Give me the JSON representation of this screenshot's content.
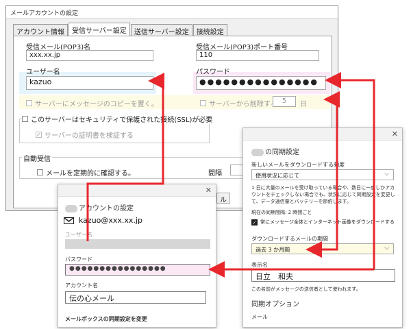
{
  "legacy": {
    "title": "メールアカウントの設定",
    "tabs": [
      "アカウント情報",
      "受信サーバー設定",
      "送信サーバー設定",
      "接続設定"
    ],
    "pop3_label": "受信メール(POP3)名",
    "pop3_value": "xxx.xx.jp",
    "port_label": "受信メール(POP3)ポート番号",
    "port_value": "110",
    "username_label": "ユーザー名",
    "username_value": "kazuo",
    "password_label": "パスワード",
    "password_value": "●●●●●●●●●●●●●●●",
    "leave_copy_label": "サーバーにメッセージのコピーを置く。",
    "delete_label": "サーバーから削除する。",
    "delete_days": "5",
    "days_unit": "日",
    "ssl_label": "このサーバーはセキュリティで保護された接続(SSL)が必要",
    "verify_cert_label": "サーバーの証明書を検証する",
    "auto_receive_title": "自動受信",
    "periodic_label": "メールを定期的に確認する。",
    "interval_label": "間隔",
    "ok_label": "ル"
  },
  "account_panel": {
    "title": "アカウントの設定",
    "email": "kazuo@xxx.xx.jp",
    "username_label": "ユーザー名",
    "password_label": "パスワード",
    "password_value": "●●●●●●●●●●●●●●●●",
    "account_name_label": "アカウント名",
    "account_name_value": "伝の心メール",
    "sync_link": "メールボックスの同期設定を変更"
  },
  "sync_panel": {
    "title": "の同期設定",
    "download_freq_label": "新しいメールをダウンロードする頻度",
    "download_freq_value": "使用状況に応じて",
    "description": "1 日に大量のメールを受け取っている場合や、数日に一度しかアカウントをチェックしない場合でも、状況に応じて同期設定を変更して、データ通信量とバッテリーを節約します。",
    "current_interval": "現在の同期間隔: 2 時間ごと",
    "always_download_label": "常にメッセージ全体とインターネット画像をダウンロードする",
    "download_period_label": "ダウンロードするメールの期間",
    "download_period_value": "過去 3 か月間",
    "display_name_label": "表示名",
    "display_name_value": "日立　和夫",
    "display_name_hint": "この名前がメッセージの送信者として使われます。",
    "sync_options_title": "同期オプション",
    "mail_label": "メール"
  },
  "colors": {
    "arrow": "#e8272d",
    "highlight_blue": "#e6f4fb",
    "highlight_pink": "#fbe8f7",
    "highlight_yellow": "#fdfbe4"
  }
}
